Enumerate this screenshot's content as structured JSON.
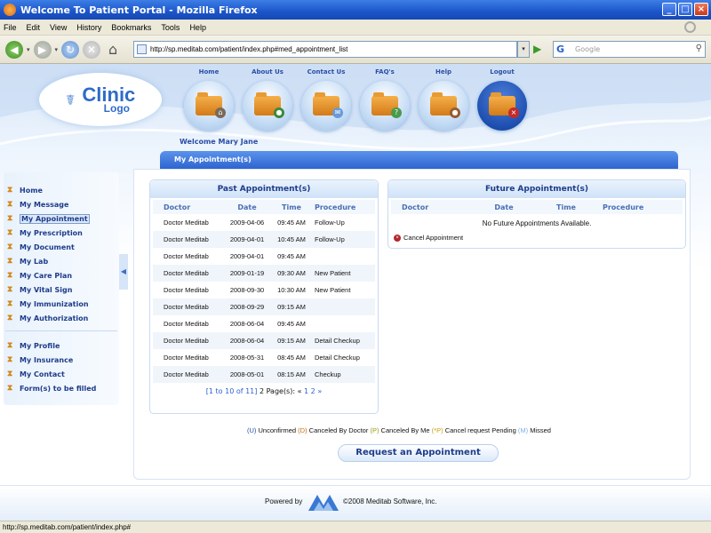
{
  "window": {
    "title": "Welcome To Patient Portal - Mozilla Firefox"
  },
  "menu": [
    "File",
    "Edit",
    "View",
    "History",
    "Bookmarks",
    "Tools",
    "Help"
  ],
  "browser": {
    "url": "http://sp.meditab.com/patient/index.php#med_appointment_list",
    "search_placeholder": "Google"
  },
  "logo": {
    "line1": "Clinic",
    "line2": "Logo"
  },
  "topnav": [
    {
      "label": "Home",
      "icon": "home-folder-icon"
    },
    {
      "label": "About Us",
      "icon": "about-folder-icon"
    },
    {
      "label": "Contact Us",
      "icon": "contact-folder-icon"
    },
    {
      "label": "FAQ's",
      "icon": "faq-folder-icon"
    },
    {
      "label": "Help",
      "icon": "help-folder-icon"
    },
    {
      "label": "Logout",
      "icon": "logout-folder-icon"
    }
  ],
  "welcome": "Welcome Mary Jane",
  "section_title": "My Appointment(s)",
  "sidebar": {
    "items": [
      "Home",
      "My Message",
      "My Appointment",
      "My Prescription",
      "My Document",
      "My Lab",
      "My Care Plan",
      "My Vital Sign",
      "My Immunization",
      "My Authorization"
    ],
    "items2": [
      "My Profile",
      "My Insurance",
      "My Contact",
      "Form(s) to be filled"
    ],
    "active": "My Appointment"
  },
  "past": {
    "title": "Past Appointment(s)",
    "columns": [
      "Doctor",
      "Date",
      "Time",
      "Procedure"
    ],
    "rows": [
      [
        "Doctor Meditab",
        "2009-04-06",
        "09:45 AM",
        "Follow-Up"
      ],
      [
        "Doctor Meditab",
        "2009-04-01",
        "10:45 AM",
        "Follow-Up"
      ],
      [
        "Doctor Meditab",
        "2009-04-01",
        "09:45 AM",
        ""
      ],
      [
        "Doctor Meditab",
        "2009-01-19",
        "09:30 AM",
        "New Patient"
      ],
      [
        "Doctor Meditab",
        "2008-09-30",
        "10:30 AM",
        "New Patient"
      ],
      [
        "Doctor Meditab",
        "2008-09-29",
        "09:15 AM",
        ""
      ],
      [
        "Doctor Meditab",
        "2008-06-04",
        "09:45 AM",
        ""
      ],
      [
        "Doctor Meditab",
        "2008-06-04",
        "09:15 AM",
        "Detail Checkup"
      ],
      [
        "Doctor Meditab",
        "2008-05-31",
        "08:45 AM",
        "Detail Checkup"
      ],
      [
        "Doctor Meditab",
        "2008-05-01",
        "08:15 AM",
        "Checkup"
      ]
    ],
    "pager": {
      "range": "[1 to 10 of 11]",
      "pages_text": "2 Page(s): «",
      "p1": "1",
      "p2": "2",
      "next": "»"
    }
  },
  "future": {
    "title": "Future Appointment(s)",
    "columns": [
      "Doctor",
      "Date",
      "Time",
      "Procedure"
    ],
    "empty": "No Future Appointments Available.",
    "cancel": "Cancel Appointment"
  },
  "legend": {
    "u_key": "(U)",
    "u": "Unconfirmed",
    "d_key": "(D)",
    "d": "Canceled By Doctor",
    "p_key": "(P)",
    "p": "Canceled By Me",
    "ps_key": "(*P)",
    "ps": "Cancel request Pending",
    "m_key": "(M)",
    "m": "Missed"
  },
  "request_button": "Request an Appointment",
  "footer": {
    "powered": "Powered by",
    "copyright": "©2008 Meditab Software, Inc."
  },
  "status": "http://sp.meditab.com/patient/index.php#",
  "colors": {
    "accent": "#2e64cf",
    "nav_text": "#2a4ea6"
  }
}
